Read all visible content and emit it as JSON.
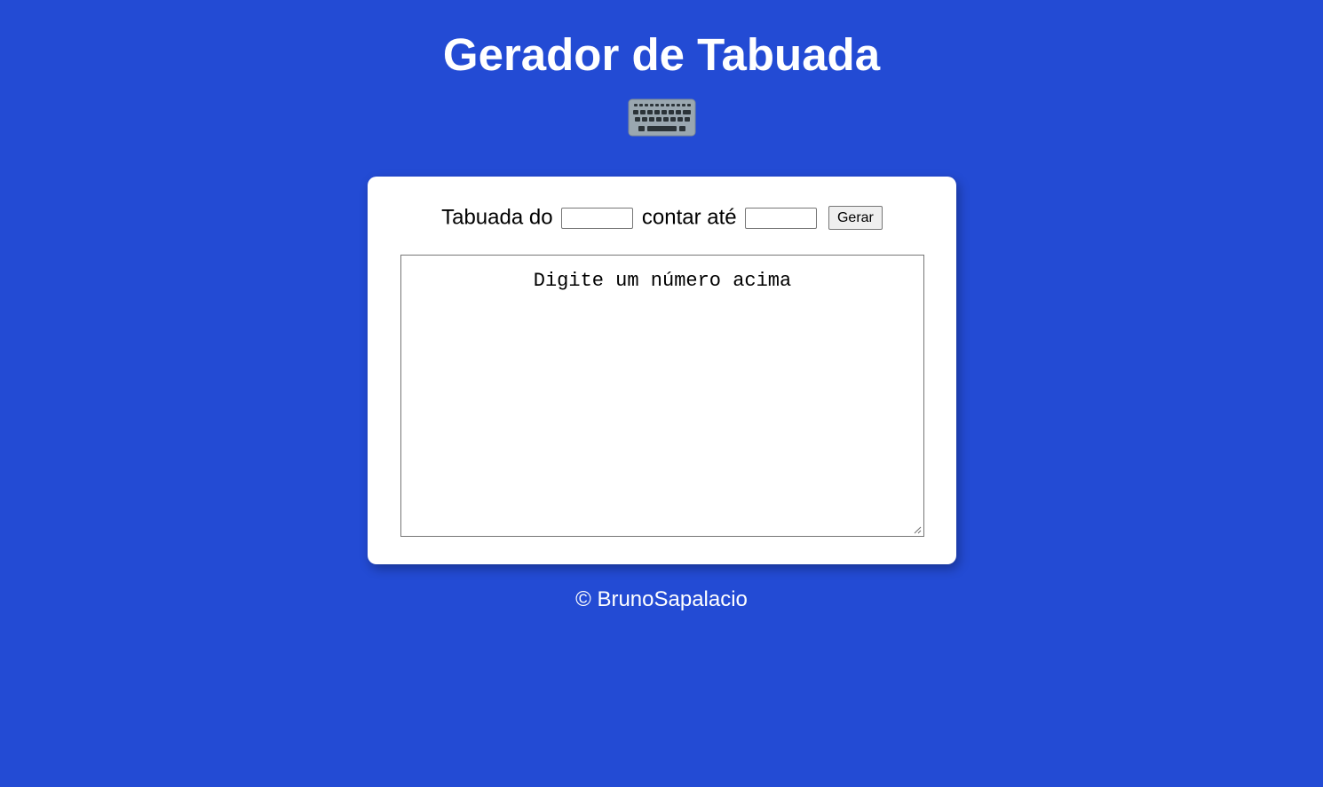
{
  "header": {
    "title": "Gerador de Tabuada",
    "icon": "keyboard-icon"
  },
  "form": {
    "label_table": "Tabuada do",
    "number_value": "",
    "label_count": "contar até",
    "limit_value": "",
    "button_label": "Gerar"
  },
  "output": {
    "text": "Digite um número acima"
  },
  "footer": {
    "text": "© BrunoSapalacio"
  },
  "colors": {
    "background": "#234bd4",
    "card": "#ffffff",
    "text_light": "#ffffff"
  }
}
